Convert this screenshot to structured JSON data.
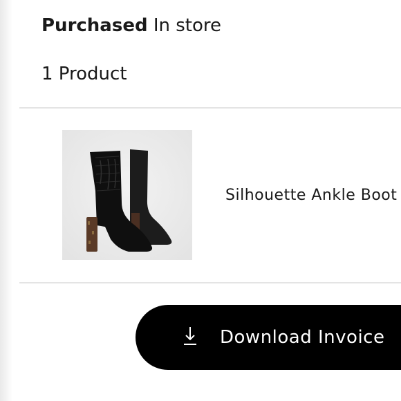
{
  "purchase": {
    "status_label": "Purchased",
    "location": "In store"
  },
  "order": {
    "product_count": "1 Product"
  },
  "product": {
    "name": "Silhouette Ankle Boot",
    "image_icon": "ankle-boot-image"
  },
  "actions": {
    "download_label": "Download Invoice",
    "download_icon": "download-icon"
  },
  "colors": {
    "button_bg": "#000000",
    "button_text": "#ffffff",
    "divider": "#e4e4e4"
  }
}
